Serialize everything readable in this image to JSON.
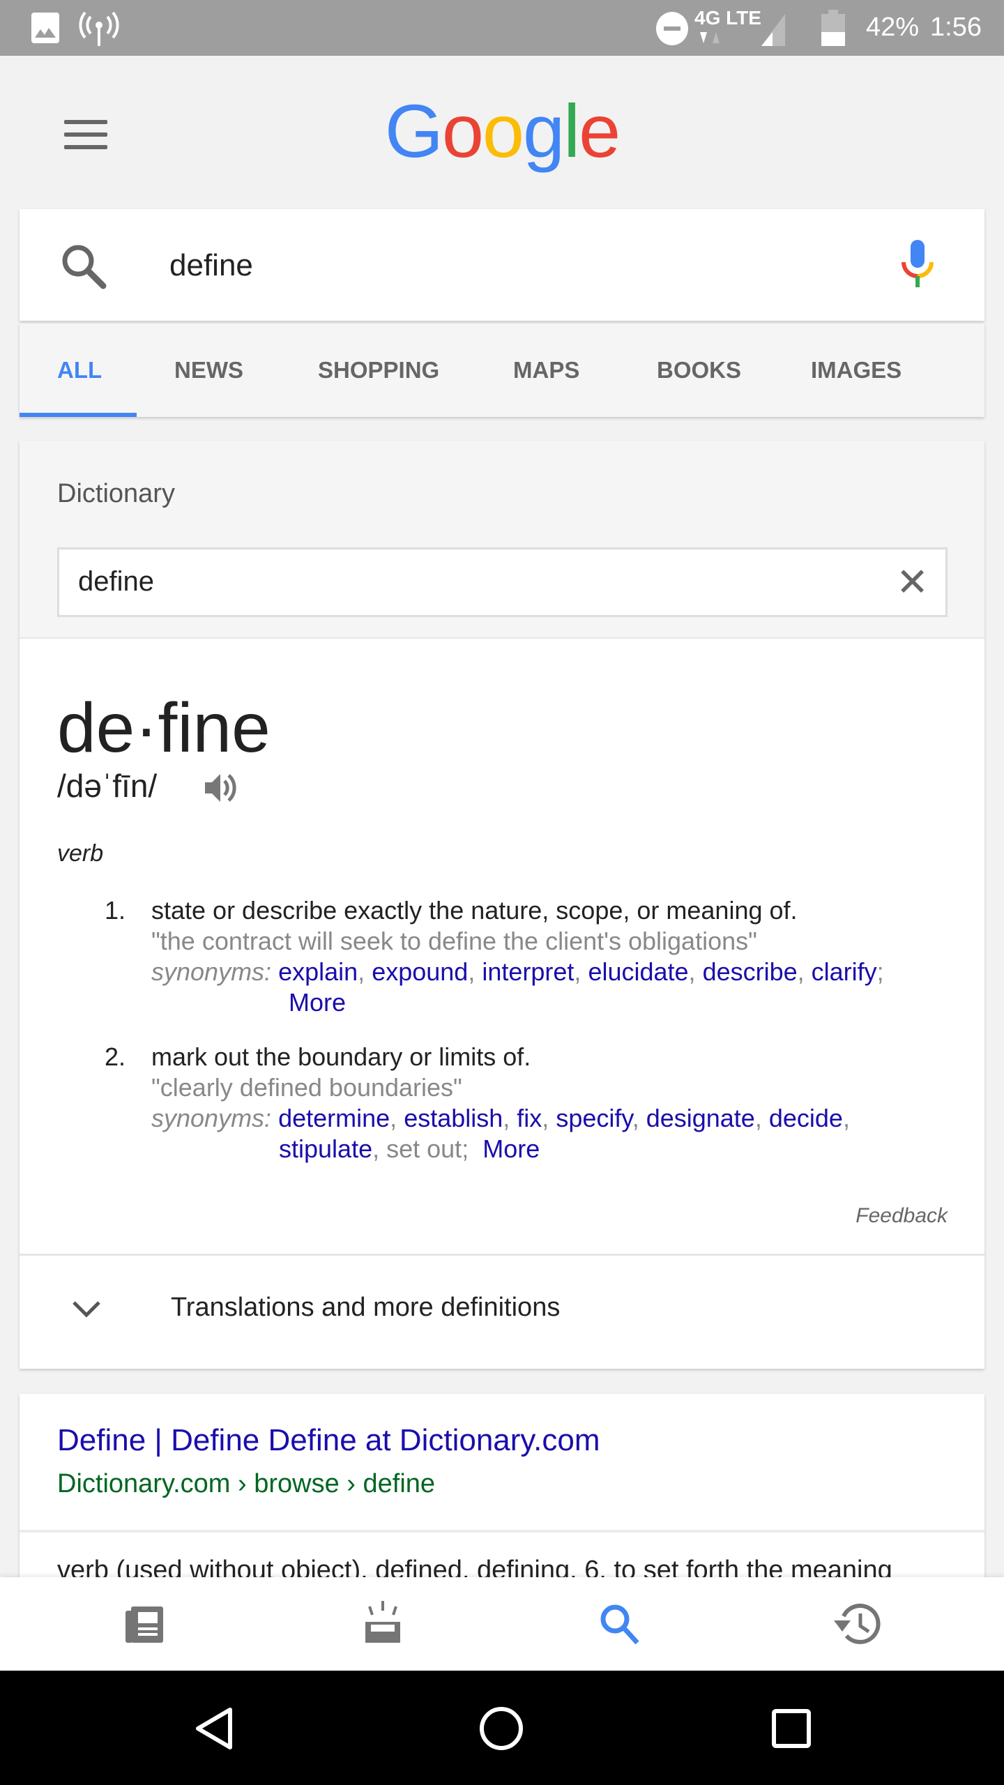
{
  "status_bar": {
    "battery": "42%",
    "time": "1:56",
    "network": "4G LTE"
  },
  "header": {
    "logo": "Google"
  },
  "search": {
    "query": "define"
  },
  "tabs": [
    {
      "label": "ALL",
      "active": true
    },
    {
      "label": "NEWS"
    },
    {
      "label": "SHOPPING"
    },
    {
      "label": "MAPS"
    },
    {
      "label": "BOOKS"
    },
    {
      "label": "IMAGES"
    }
  ],
  "colors": {
    "accent": "#4285f4",
    "link": "#1a0dab",
    "url": "#006621"
  },
  "dictionary": {
    "label": "Dictionary",
    "input_value": "define",
    "word": "de·fine",
    "pronunciation": "/dəˈfīn/",
    "part_of_speech": "verb",
    "definitions": [
      {
        "num": "1.",
        "text": "state or describe exactly the nature, scope, or meaning of.",
        "example": "\"the contract will seek to define the client's obligations\"",
        "synonyms_label": "synonyms:",
        "synonyms": [
          "explain",
          "expound",
          "interpret",
          "elucidate",
          "describe",
          "clarify"
        ],
        "more": "More"
      },
      {
        "num": "2.",
        "text": "mark out the boundary or limits of.",
        "example": "\"clearly defined boundaries\"",
        "synonyms_label": "synonyms:",
        "synonyms": [
          "determine",
          "establish",
          "fix",
          "specify",
          "designate",
          "decide",
          "stipulate"
        ],
        "extra": "set out",
        "more": "More"
      }
    ],
    "feedback": "Feedback",
    "translations": "Translations and more definitions"
  },
  "result": {
    "title": "Define | Define Define at Dictionary.com",
    "url": "Dictionary.com › browse › define",
    "snippet": "verb (used without object), defined, defining. 6. to set forth the meaning"
  },
  "bottom_nav": [
    {
      "icon": "newspaper-icon"
    },
    {
      "icon": "upcoming-icon"
    },
    {
      "icon": "search-icon",
      "active": true
    },
    {
      "icon": "history-icon"
    }
  ]
}
